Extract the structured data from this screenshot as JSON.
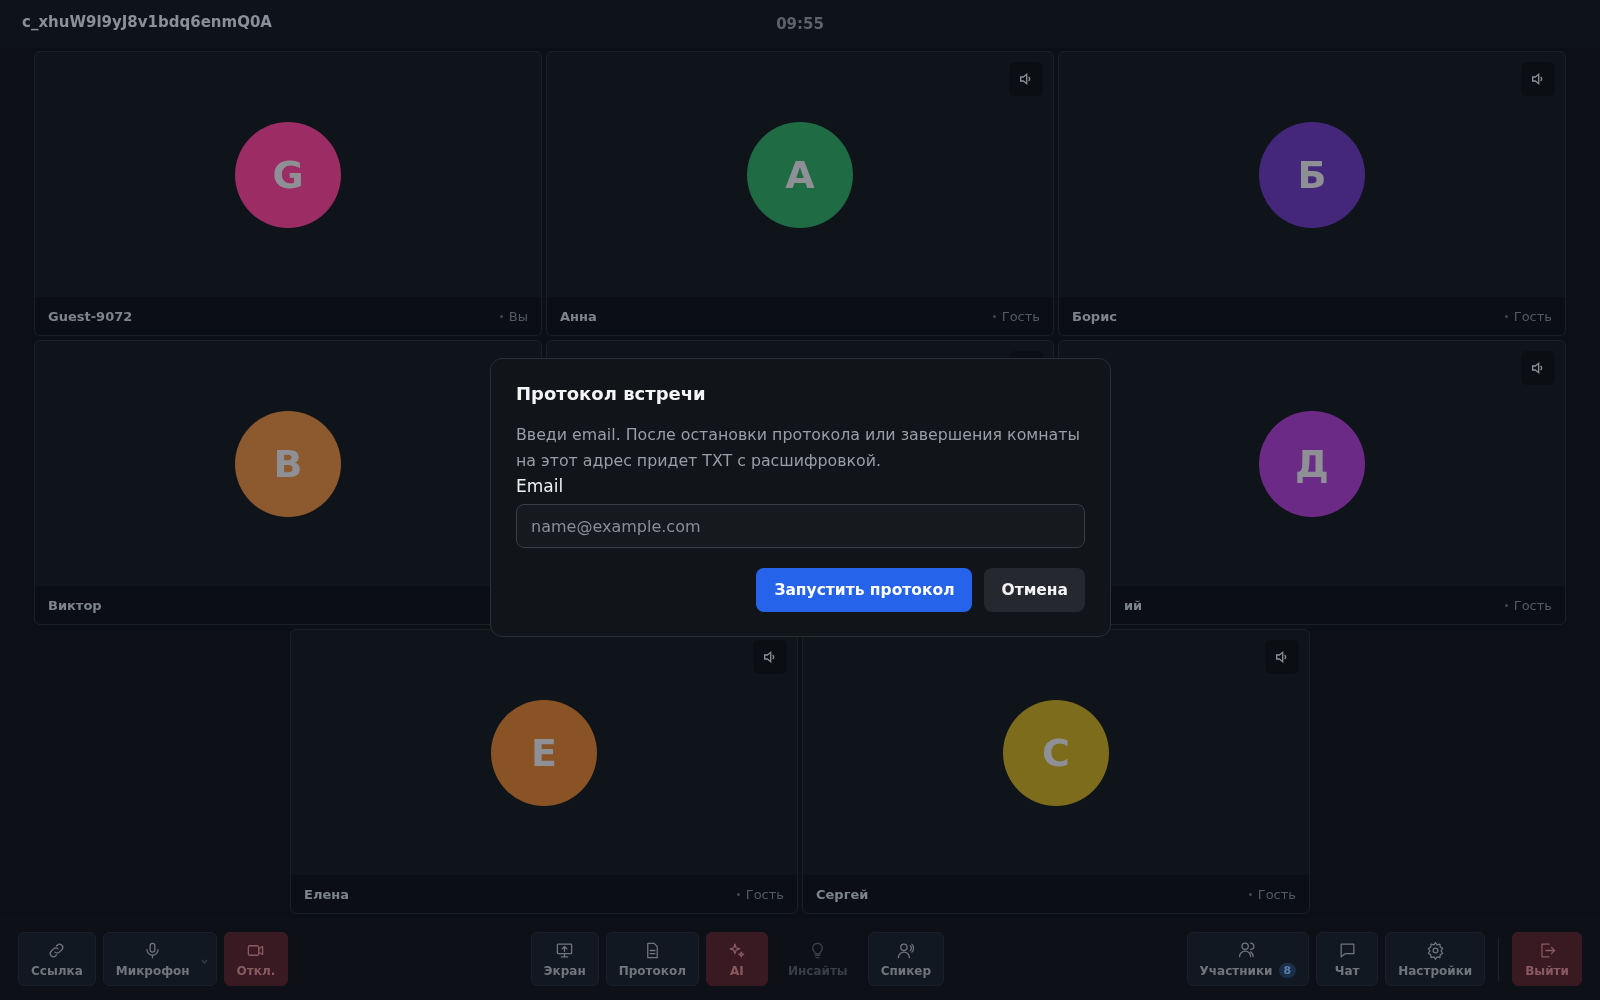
{
  "header": {
    "room": "c_xhuW9l9yJ8v1bdq6enmQ0A",
    "time": "09:55"
  },
  "tiles": [
    {
      "initial": "G",
      "color": "#9b2d64",
      "name": "Guest-9072",
      "role": "Вы",
      "speaker": false
    },
    {
      "initial": "А",
      "color": "#1f6b44",
      "name": "Анна",
      "role": "Гость",
      "speaker": true
    },
    {
      "initial": "Б",
      "color": "#44277a",
      "name": "Борис",
      "role": "Гость",
      "speaker": true
    },
    {
      "initial": "В",
      "color": "#8c5a2e",
      "name": "Виктор",
      "speaker": false
    },
    {
      "speaker": true
    },
    {
      "initial": "Д",
      "color": "#6a2a86",
      "name": "ий",
      "name_clipped": true,
      "role": "Гость",
      "speaker": true
    },
    {
      "initial": "Е",
      "color": "#8a5326",
      "name": "Елена",
      "role": "Гость",
      "speaker": true
    },
    {
      "initial": "С",
      "color": "#7d6c1c",
      "name": "Сергей",
      "role": "Гость",
      "speaker": true
    }
  ],
  "toolbar": {
    "left": [
      {
        "label": "Ссылка",
        "kind": "normal",
        "disabled": false,
        "caret": false
      },
      {
        "label": "Микрофон",
        "kind": "normal",
        "disabled": false,
        "caret": true
      },
      {
        "label": "Откл.",
        "kind": "danger",
        "disabled": false,
        "caret": false
      }
    ],
    "center": [
      {
        "label": "Экран",
        "kind": "normal",
        "disabled": false,
        "caret": false
      },
      {
        "label": "Протокол",
        "kind": "normal",
        "disabled": false,
        "caret": false
      },
      {
        "label": "AI",
        "kind": "danger",
        "disabled": false,
        "caret": false
      },
      {
        "label": "Инсайты",
        "kind": "normal",
        "disabled": true,
        "caret": false
      },
      {
        "label": "Спикер",
        "kind": "normal",
        "disabled": false,
        "caret": false
      }
    ],
    "right": [
      {
        "label": "Участники",
        "badge": "8",
        "kind": "normal",
        "disabled": false,
        "caret": false
      },
      {
        "label": "Чат",
        "kind": "normal",
        "disabled": false,
        "caret": false
      },
      {
        "label": "Настройки",
        "kind": "normal",
        "disabled": false,
        "caret": false
      },
      {
        "label": "Выйти",
        "kind": "danger",
        "disabled": false,
        "caret": false
      }
    ]
  },
  "dialog": {
    "title": "Протокол встречи",
    "description": "Введи email. После остановки протокола или завершения комнаты на этот адрес придет TXT с расшифровкой.",
    "field_label": "Email",
    "placeholder": "name@example.com",
    "primary_button": "Запустить протокол",
    "secondary_button": "Отмена"
  }
}
